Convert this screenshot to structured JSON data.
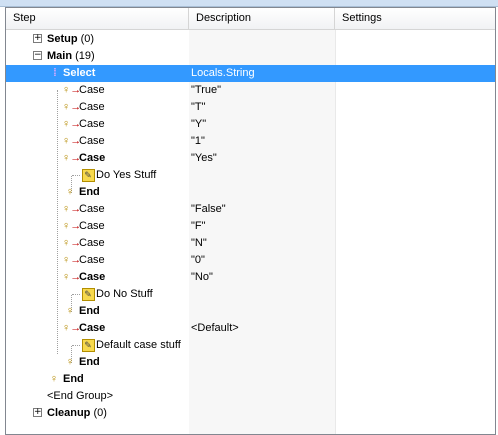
{
  "columns": {
    "step": "Step",
    "description": "Description",
    "settings": "Settings"
  },
  "tree": {
    "setup": {
      "label": "Setup",
      "count": "(0)"
    },
    "main": {
      "label": "Main",
      "count": "(19)"
    },
    "select": {
      "label": "Select",
      "desc": "Locals.String"
    },
    "rows": [
      {
        "label": "Case",
        "desc": "\"True\""
      },
      {
        "label": "Case",
        "desc": "\"T\""
      },
      {
        "label": "Case",
        "desc": "\"Y\""
      },
      {
        "label": "Case",
        "desc": "\"1\""
      },
      {
        "label": "Case",
        "desc": "\"Yes\""
      },
      {
        "label": "Do Yes Stuff",
        "desc": ""
      },
      {
        "label": "End",
        "desc": ""
      },
      {
        "label": "Case",
        "desc": "\"False\""
      },
      {
        "label": "Case",
        "desc": "\"F\""
      },
      {
        "label": "Case",
        "desc": "\"N\""
      },
      {
        "label": "Case",
        "desc": "\"0\""
      },
      {
        "label": "Case",
        "desc": "\"No\""
      },
      {
        "label": "Do No Stuff",
        "desc": ""
      },
      {
        "label": "End",
        "desc": ""
      },
      {
        "label": "Case",
        "desc": "<Default>"
      },
      {
        "label": "Default case stuff",
        "desc": ""
      },
      {
        "label": "End",
        "desc": ""
      }
    ],
    "select_end": {
      "label": "End"
    },
    "end_group": {
      "label": "<End Group>"
    },
    "cleanup": {
      "label": "Cleanup",
      "count": "(0)"
    }
  },
  "colors": {
    "selection": "#3399ff",
    "header_bg": "#f1f2f4"
  }
}
